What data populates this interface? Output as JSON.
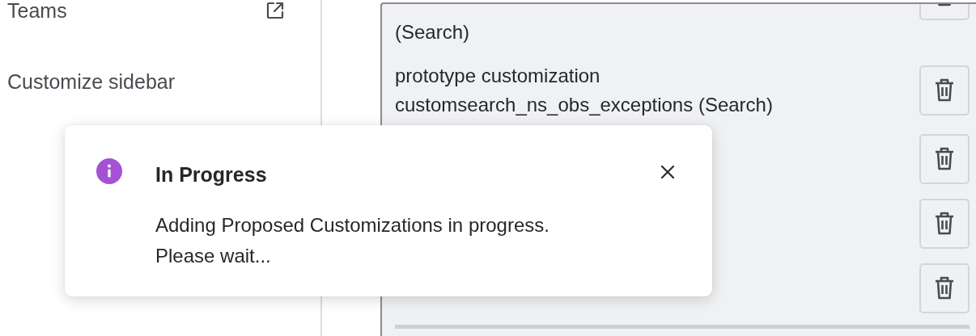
{
  "sidebar": {
    "items": [
      {
        "label": "Teams",
        "external": true
      },
      {
        "label": "Customize sidebar",
        "external": false
      }
    ]
  },
  "customizations": {
    "rows": [
      {
        "kind": "entry",
        "lines": [
          "(Search)"
        ]
      },
      {
        "kind": "entry",
        "lines": [
          "prototype customization",
          "customsearch_ns_obs_exceptions (Search)"
        ]
      },
      {
        "kind": "covered"
      },
      {
        "kind": "covered"
      },
      {
        "kind": "covered"
      }
    ]
  },
  "toast": {
    "kind": "info",
    "title": "In Progress",
    "message": "Adding Proposed Customizations in progress. Please wait..."
  }
}
